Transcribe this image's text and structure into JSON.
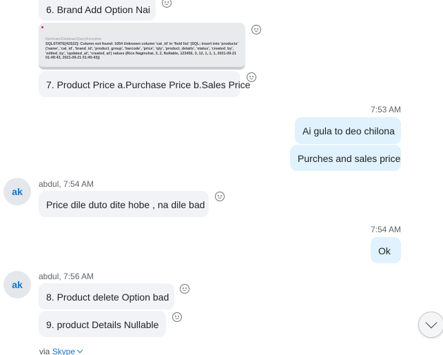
{
  "messages": {
    "m6": "6. Brand Add Option Nai",
    "screenshot": {
      "header": "Illuminate\\Database\\QueryException",
      "error": "SQLSTATE[42S22]: Column not found: 1054 Unknown column 'cat_id' in 'field list' (SQL: insert into 'products' ('name', 'cat_id', 'brand_id', 'product_group', 'barcode', 'price', 'qty', 'product_details', 'status', 'created_by', 'edited_by', 'updated_at', 'created_at') values (Rice Naginshai, 3, 2, Nullable, 123456, 3, 12, 1, 1, 1, 2021-09-21 01:49:43, 2021-09-21 01:49:43))"
    },
    "m7": "7. Product Price a.Purchase Price b.Sales Price"
  },
  "out1": {
    "time": "7:53 AM",
    "a": "Ai gula to deo chilona",
    "b": "Purches and sales price"
  },
  "in1": {
    "avatar": "ak",
    "sender": "abdul, 7:54 AM",
    "text": "Price dile duto dite hobe , na dile bad"
  },
  "out2": {
    "time": "7:54 AM",
    "text": "Ok"
  },
  "in2": {
    "avatar": "ak",
    "sender": "abdul, 7:56 AM",
    "a": "8. Product delete Option bad",
    "b": "9. product Details Nullable"
  },
  "footer": {
    "via": "via",
    "link": "Skype"
  },
  "icons": {
    "reaction": "smiley-reaction-icon",
    "scroll": "chevron-down-icon"
  }
}
